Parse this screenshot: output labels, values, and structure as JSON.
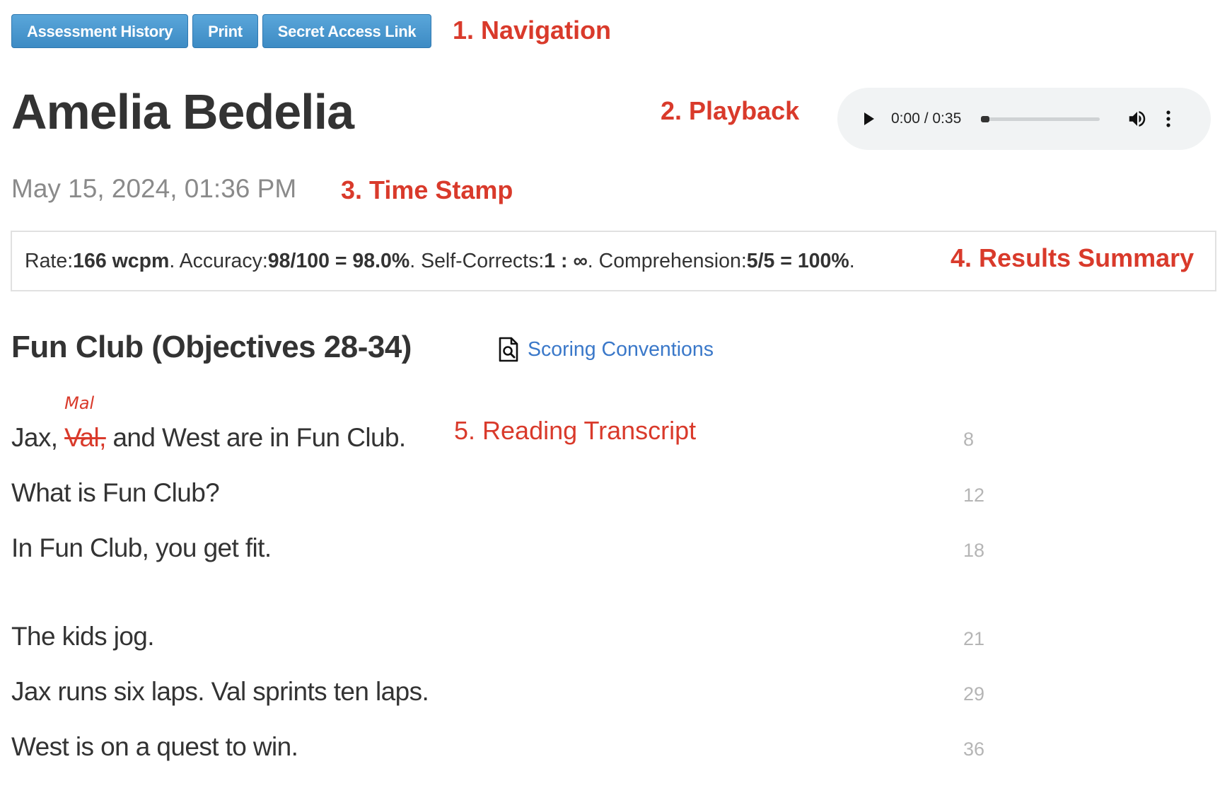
{
  "navigation": {
    "buttons": [
      {
        "label": "Assessment History"
      },
      {
        "label": "Print"
      },
      {
        "label": "Secret Access Link"
      }
    ]
  },
  "annotations": {
    "navigation": "1. Navigation",
    "playback": "2. Playback",
    "time_stamp": "3. Time Stamp",
    "results_summary": "4. Results Summary",
    "reading_transcript": "5.  Reading Transcript"
  },
  "student": {
    "name": "Amelia Bedelia"
  },
  "player": {
    "time": "0:00 / 0:35",
    "progress_fraction": 0.0,
    "icons": [
      "play-icon",
      "volume-icon",
      "more-vertical-icon"
    ]
  },
  "timestamp": "May 15, 2024, 01:36 PM",
  "summary": {
    "rate_label": "Rate: ",
    "rate_value": "166 wcpm",
    "accuracy_label": ". Accuracy: ",
    "accuracy_value": "98/100 = 98.0%",
    "self_corrects_label": ". Self-Corrects: ",
    "self_corrects_value": "1 : ∞",
    "comprehension_label": ". Comprehension: ",
    "comprehension_value": "5/5 = 100%",
    "end": "."
  },
  "passage": {
    "title": "Fun Club (Objectives 28-34)",
    "scoring_link": "Scoring Conventions",
    "lines": [
      {
        "pre": "Jax, ",
        "error_word": "Val,",
        "error_mark": "Mal",
        "post": " and West are in Fun Club.",
        "count": "8"
      },
      {
        "text": "What is Fun Club?",
        "count": "12"
      },
      {
        "text": "In Fun Club, you get fit.",
        "count": "18"
      },
      {
        "text": "The kids jog.",
        "count": "21"
      },
      {
        "text": "Jax runs six laps. Val sprints ten laps.",
        "count": "29"
      },
      {
        "text": "West is on a quest to win.",
        "count": "36"
      }
    ]
  },
  "colors": {
    "button_blue": "#4a97cf",
    "annotation_red": "#d93a2b",
    "link_blue": "#3a78c9",
    "player_bg": "#f1f3f4"
  }
}
